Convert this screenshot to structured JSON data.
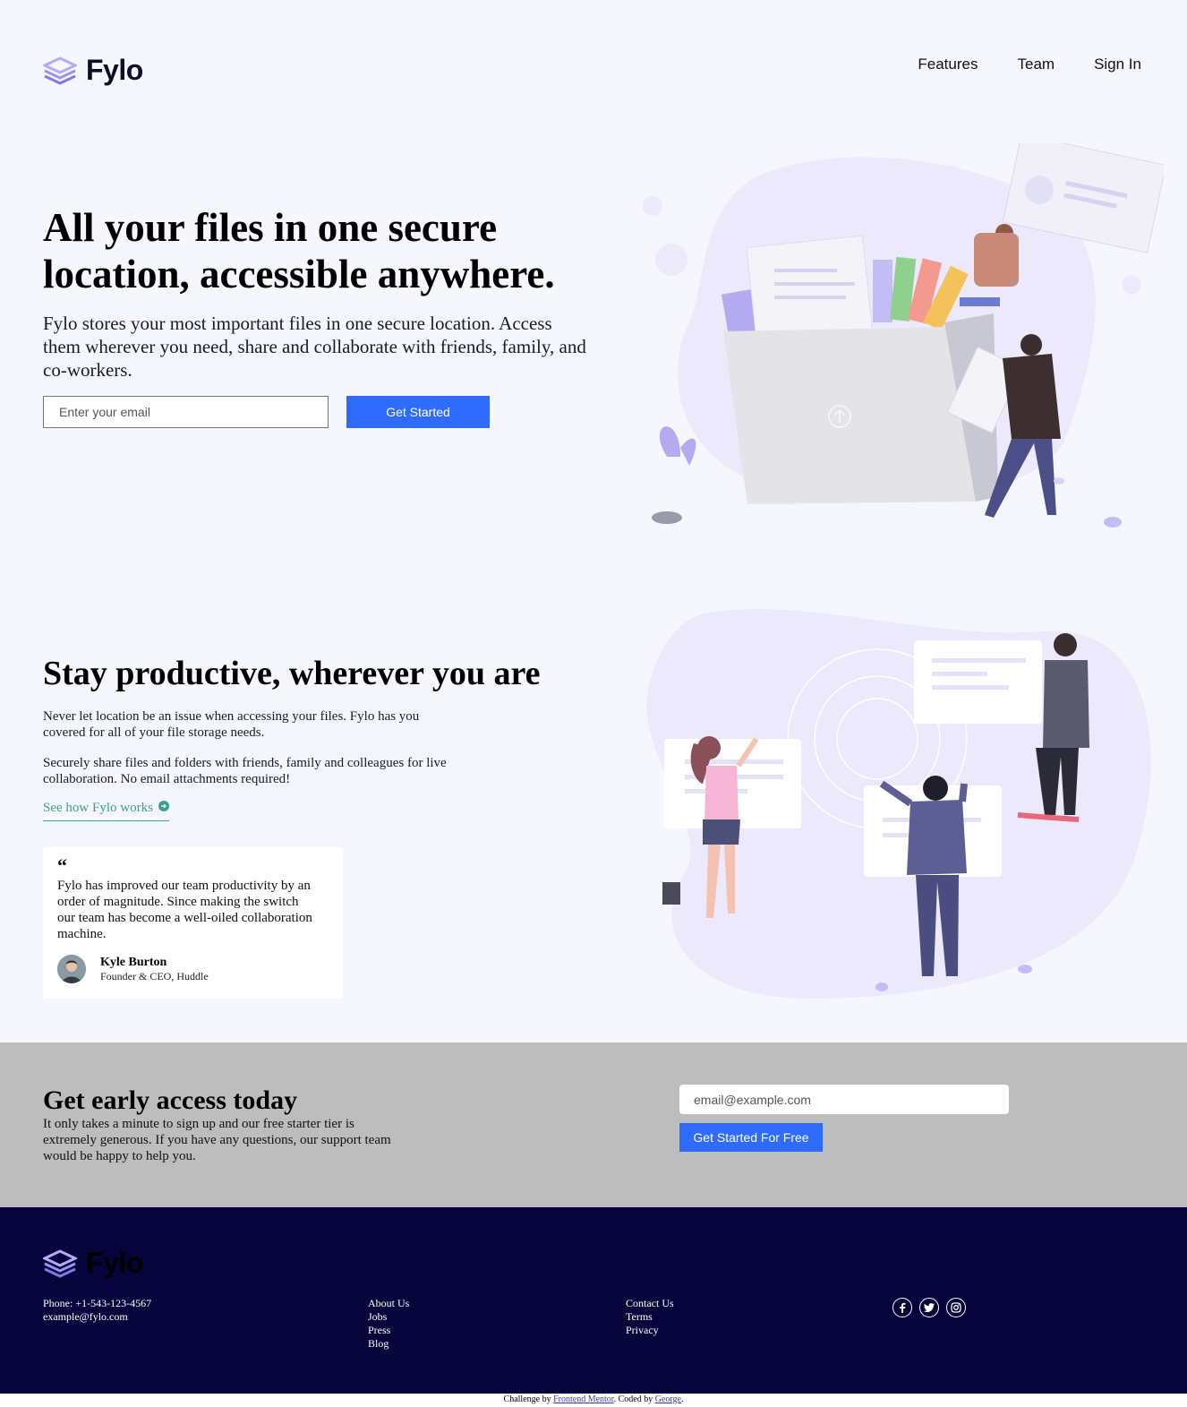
{
  "header": {
    "brand": "Fylo",
    "nav": [
      "Features",
      "Team",
      "Sign In"
    ]
  },
  "hero": {
    "title": "All your files in one secure location, accessible anywhere.",
    "text": "Fylo stores your most important files in one secure location. Access them wherever you need, share and collaborate with friends, family, and co-workers.",
    "email_placeholder": "Enter your email",
    "button": "Get Started"
  },
  "productive": {
    "title": "Stay productive, wherever you are",
    "p1": "Never let location be an issue when accessing your files. Fylo has you covered for all of your file storage needs.",
    "p2": "Securely share files and folders with friends, family and colleagues for live collaboration. No email attachments required!",
    "link": "See how Fylo works",
    "testimonial": {
      "quote": "Fylo has improved our team productivity by an order of magnitude. Since making the switch our team has become a well-oiled collaboration machine.",
      "name": "Kyle Burton",
      "role": "Founder & CEO, Huddle"
    }
  },
  "early_access": {
    "title": "Get early access today",
    "text": "It only takes a minute to sign up and our free starter tier is extremely generous. If you have any questions, our support team would be happy to help you.",
    "email_placeholder": "email@example.com",
    "button": "Get Started For Free"
  },
  "footer": {
    "brand": "Fylo",
    "phone": "Phone: +1-543-123-4567",
    "email": "example@fylo.com",
    "links_col1": [
      "About Us",
      "Jobs",
      "Press",
      "Blog"
    ],
    "links_col2": [
      "Contact Us",
      "Terms",
      "Privacy"
    ],
    "social_icons": [
      "facebook-icon",
      "twitter-icon",
      "instagram-icon"
    ],
    "credit_prefix": "Challenge by ",
    "credit_link1": "Frontend Mentor",
    "credit_mid": ". Coded by ",
    "credit_link2": "George",
    "credit_suffix": "."
  },
  "colors": {
    "accent_blue": "#2f6bff",
    "teal": "#3ba197",
    "footer_bg": "#07043b",
    "page_bg": "#f6f6fd"
  }
}
